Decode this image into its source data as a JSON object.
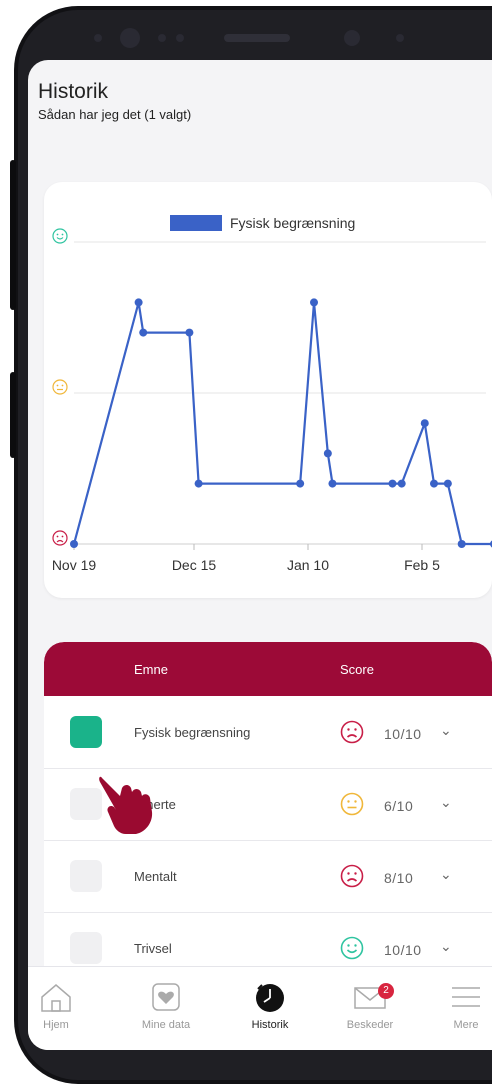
{
  "header": {
    "title": "Historik",
    "subtitle": "Sådan har jeg det (1 valgt)"
  },
  "chart_data": {
    "type": "line",
    "legend": "Fysisk begrænsning",
    "x_ticks": [
      "Nov 19",
      "Dec 15",
      "Jan 10",
      "Feb 5"
    ],
    "y_axis": [
      "sad-face",
      "neutral-face",
      "happy-face"
    ],
    "ylim": [
      0,
      10
    ],
    "series": [
      {
        "name": "Fysisk begrænsning",
        "color": "#3a62c7",
        "x": [
          "Nov 19",
          "Dec 3",
          "Dec 4",
          "Dec 14",
          "Dec 16",
          "Jan 7",
          "Jan 10",
          "Jan 13",
          "Jan 14",
          "Jan 27",
          "Jan 29",
          "Feb 3",
          "Feb 5",
          "Feb 8",
          "Feb 11",
          "Feb 18"
        ],
        "values": [
          0,
          8,
          7,
          7,
          2,
          2,
          8,
          3,
          2,
          2,
          2,
          4,
          2,
          2,
          0,
          0
        ]
      }
    ]
  },
  "table": {
    "header_topic": "Emne",
    "header_score": "Score",
    "rows": [
      {
        "topic": "Fysisk begrænsning",
        "score": "10/10",
        "face": "sad-face",
        "checked": true
      },
      {
        "topic": "Smerte",
        "score": "6/10",
        "face": "neutral-face",
        "checked": false
      },
      {
        "topic": "Mentalt",
        "score": "8/10",
        "face": "sad-face",
        "checked": false
      },
      {
        "topic": "Trivsel",
        "score": "10/10",
        "face": "happy-face",
        "checked": false
      }
    ]
  },
  "tabbar": {
    "items": [
      {
        "label": "Hjem",
        "icon": "home-icon"
      },
      {
        "label": "Mine data",
        "icon": "heart-icon"
      },
      {
        "label": "Historik",
        "icon": "clock-icon",
        "active": true
      },
      {
        "label": "Beskeder",
        "icon": "mail-icon",
        "badge": "2"
      },
      {
        "label": "Mere",
        "icon": "menu-icon"
      }
    ]
  },
  "colors": {
    "brand": "#9c0a37",
    "series": "#3a62c7",
    "checked": "#1ab38a",
    "happy": "#2fc4a0",
    "neutral": "#f0b73a",
    "sad": "#c81e47"
  }
}
